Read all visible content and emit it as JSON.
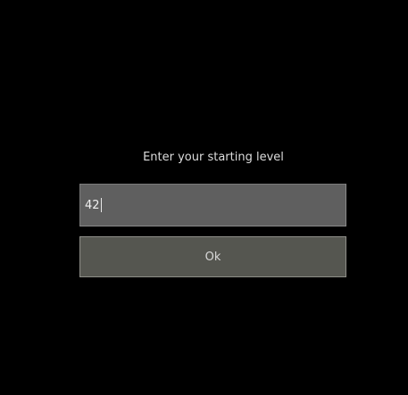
{
  "dialog": {
    "prompt": "Enter your starting level",
    "input_value": "42",
    "ok_label": "Ok"
  },
  "colors": {
    "background": "#000000",
    "input_background": "#5f5f5f",
    "button_background": "#555650",
    "text": "#dcdcdc"
  }
}
